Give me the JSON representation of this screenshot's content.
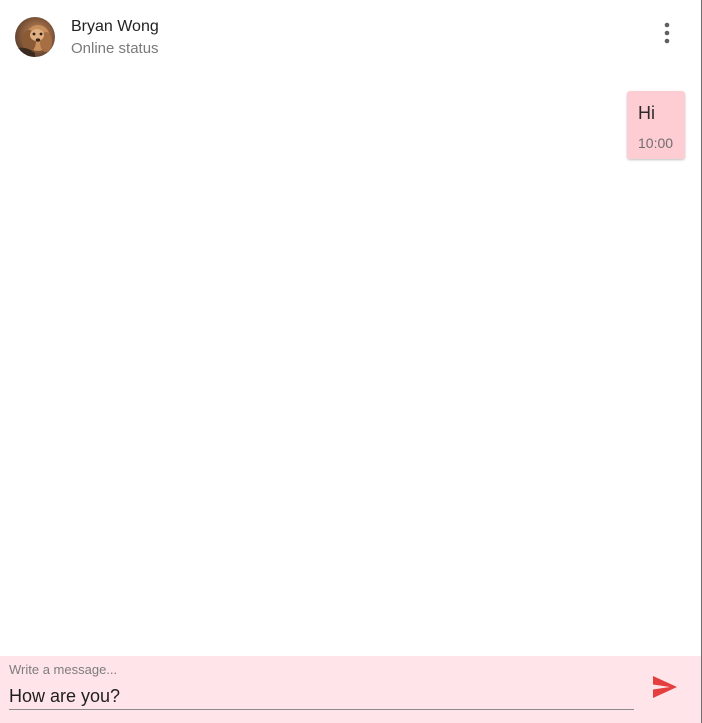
{
  "header": {
    "contact_name": "Bryan Wong",
    "status_text": "Online status",
    "menu_icon": "more-vertical-icon"
  },
  "messages": [
    {
      "text": "Hi",
      "time": "10:00",
      "direction": "outgoing"
    }
  ],
  "composer": {
    "label": "Write a message...",
    "value": "How are you?",
    "send_icon": "send-icon"
  },
  "colors": {
    "outgoing_bubble": "#fecdd3",
    "composer_background": "#ffe4e9",
    "send_icon": "#e53e3e"
  }
}
